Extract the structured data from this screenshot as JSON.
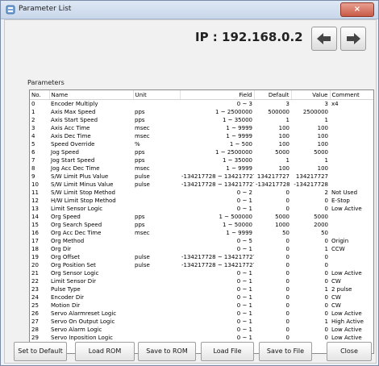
{
  "window": {
    "title": "Parameter List"
  },
  "header": {
    "ip_label": "IP : 192.168.0.2"
  },
  "params": {
    "label": "Parameters"
  },
  "table": {
    "columns": [
      "No.",
      "Name",
      "Unit",
      "Field",
      "Default",
      "Value",
      "Comment"
    ],
    "rows": [
      [
        "0",
        "Encoder Multiply",
        "",
        "0 ~ 3",
        "3",
        "3",
        "x4"
      ],
      [
        "1",
        "Axis Max Speed",
        "pps",
        "1 ~ 2500000",
        "500000",
        "2500000",
        ""
      ],
      [
        "2",
        "Axis Start Speed",
        "pps",
        "1 ~ 35000",
        "1",
        "1",
        ""
      ],
      [
        "3",
        "Axis Acc Time",
        "msec",
        "1 ~ 9999",
        "100",
        "100",
        ""
      ],
      [
        "4",
        "Axis Dec Time",
        "msec",
        "1 ~ 9999",
        "100",
        "100",
        ""
      ],
      [
        "5",
        "Speed Override",
        "%",
        "1 ~ 500",
        "100",
        "100",
        ""
      ],
      [
        "6",
        "Jog Speed",
        "pps",
        "1 ~ 2500000",
        "5000",
        "5000",
        ""
      ],
      [
        "7",
        "Jog Start Speed",
        "pps",
        "1 ~ 35000",
        "1",
        "1",
        ""
      ],
      [
        "8",
        "Jog Acc Dec Time",
        "msec",
        "1 ~ 9999",
        "100",
        "100",
        ""
      ],
      [
        "9",
        "S/W Limit Plus Value",
        "pulse",
        "-134217728 ~ 134217727",
        "134217727",
        "134217727",
        ""
      ],
      [
        "10",
        "S/W Limit Minus Value",
        "pulse",
        "-134217728 ~ 134217727",
        "-134217728",
        "-134217728",
        ""
      ],
      [
        "11",
        "S/W Limit Stop Method",
        "",
        "0 ~ 2",
        "0",
        "2",
        "Not Used"
      ],
      [
        "12",
        "H/W Limit Stop Method",
        "",
        "0 ~ 1",
        "0",
        "0",
        "E-Stop"
      ],
      [
        "13",
        "Limit Sensor Logic",
        "",
        "0 ~ 1",
        "0",
        "0",
        "Low Active"
      ],
      [
        "14",
        "Org Speed",
        "pps",
        "1 ~ 500000",
        "5000",
        "5000",
        ""
      ],
      [
        "15",
        "Org Search Speed",
        "pps",
        "1 ~ 50000",
        "1000",
        "2000",
        ""
      ],
      [
        "16",
        "Org Acc Dec Time",
        "msec",
        "1 ~ 9999",
        "50",
        "50",
        ""
      ],
      [
        "17",
        "Org Method",
        "",
        "0 ~ 5",
        "0",
        "0",
        "Origin"
      ],
      [
        "18",
        "Org Dir",
        "",
        "0 ~ 1",
        "0",
        "1",
        "CCW"
      ],
      [
        "19",
        "Org Offset",
        "pulse",
        "-134217728 ~ 134217727",
        "0",
        "0",
        ""
      ],
      [
        "20",
        "Org Position Set",
        "pulse",
        "-134217728 ~ 134217727",
        "0",
        "0",
        ""
      ],
      [
        "21",
        "Org Sensor Logic",
        "",
        "0 ~ 1",
        "0",
        "0",
        "Low Active"
      ],
      [
        "22",
        "Limit Sensor Dir",
        "",
        "0 ~ 1",
        "0",
        "0",
        "CW"
      ],
      [
        "23",
        "Pulse Type",
        "",
        "0 ~ 1",
        "0",
        "1",
        "2 pulse"
      ],
      [
        "24",
        "Encoder Dir",
        "",
        "0 ~ 1",
        "0",
        "0",
        "CW"
      ],
      [
        "25",
        "Motion Dir",
        "",
        "0 ~ 1",
        "0",
        "0",
        "CW"
      ],
      [
        "26",
        "Servo Alarmreset Logic",
        "",
        "0 ~ 1",
        "0",
        "0",
        "Low Active"
      ],
      [
        "27",
        "Servo On Output Logic",
        "",
        "0 ~ 1",
        "0",
        "1",
        "High Active"
      ],
      [
        "28",
        "Servo Alarm Logic",
        "",
        "0 ~ 1",
        "0",
        "0",
        "Low Active"
      ],
      [
        "29",
        "Servo Inposition Logic",
        "",
        "0 ~ 1",
        "0",
        "0",
        "Low Active"
      ]
    ]
  },
  "footer": {
    "set_default": "Set to Default",
    "load_rom": "Load ROM",
    "save_rom": "Save to ROM",
    "load_file": "Load File",
    "save_file": "Save to File",
    "close": "Close"
  },
  "icons": {
    "back": "arrow-left-icon",
    "forward": "arrow-right-icon",
    "app": "app-icon",
    "close": "close-icon"
  }
}
